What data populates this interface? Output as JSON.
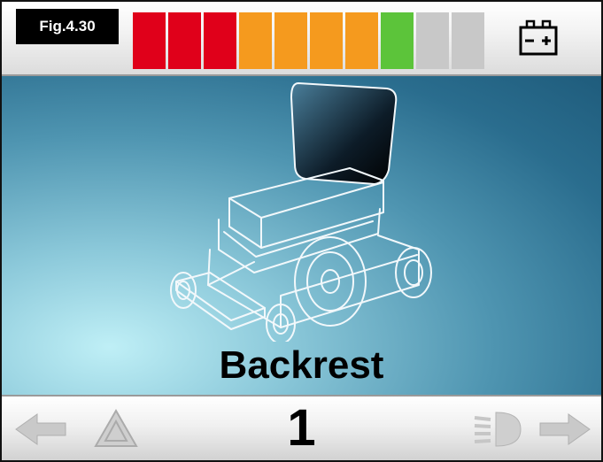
{
  "figure_label": "Fig.4.30",
  "battery": {
    "level_segments": 8,
    "total_segments": 10,
    "segment_colors": [
      "#e0001a",
      "#e0001a",
      "#e0001a",
      "#f59a1e",
      "#f59a1e",
      "#f59a1e",
      "#f59a1e",
      "#5cc43a",
      "#c8c8c8",
      "#c8c8c8"
    ],
    "icon": "battery-icon"
  },
  "mode": {
    "label": "Backrest",
    "image": "power-wheelchair-illustration"
  },
  "profile": {
    "number": "1"
  },
  "bottom_icons": {
    "left": [
      "arrow-left-icon",
      "hazard-warning-icon"
    ],
    "right": [
      "headlight-icon",
      "arrow-right-icon"
    ]
  },
  "colors": {
    "display_bg": "#2a6d8e",
    "highlight_red": "#e0001a",
    "highlight_orange": "#f59a1e",
    "highlight_green": "#5cc43a"
  }
}
